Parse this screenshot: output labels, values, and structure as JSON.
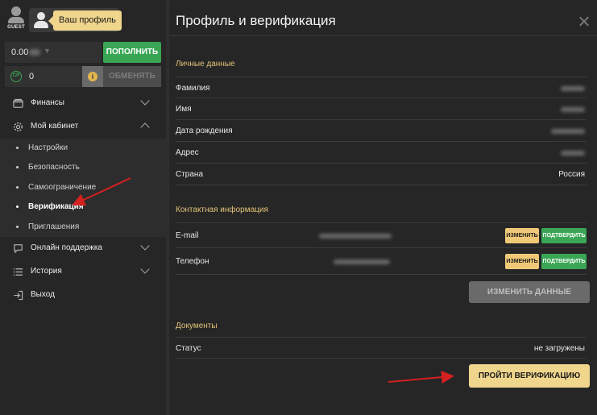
{
  "header": {
    "guest_label": "GUEST",
    "profile_suffix": "ru",
    "tooltip": "Ваш профиль"
  },
  "balance": {
    "value_prefix": "0.00",
    "topup_label": "ПОПОЛНИТЬ"
  },
  "cp": {
    "icon_text": "CP",
    "value": "0",
    "exchange_label": "ОБМЕНЯТЬ"
  },
  "nav": {
    "finance": "Финансы",
    "cabinet": "Мой кабинет",
    "cabinet_items": [
      "Настройки",
      "Безопасность",
      "Самоограничение",
      "Верификация",
      "Приглашения"
    ],
    "support": "Онлайн поддержка",
    "history": "История",
    "logout": "Выход"
  },
  "panel": {
    "title": "Профиль и верификация",
    "personal": {
      "title": "Личные данные",
      "rows": [
        {
          "label": "Фамилия",
          "value": ""
        },
        {
          "label": "Имя",
          "value": ""
        },
        {
          "label": "Дата рождения",
          "value": ""
        },
        {
          "label": "Адрес",
          "value": ""
        },
        {
          "label": "Страна",
          "value": "Россия"
        }
      ]
    },
    "contact": {
      "title": "Контактная информация",
      "rows": [
        {
          "label": "E-mail",
          "edit": "ИЗМЕНИТЬ",
          "confirm": "ПОДТВЕРДИТЬ"
        },
        {
          "label": "Телефон",
          "edit": "ИЗМЕНИТЬ",
          "confirm": "ПОДТВЕРДИТЬ"
        }
      ]
    },
    "change_data": "ИЗМЕНИТЬ ДАННЫЕ",
    "documents": {
      "title": "Документы",
      "status_label": "Статус",
      "status_value": "не загружены"
    },
    "verify_button": "ПРОЙТИ ВЕРИФИКАЦИЮ"
  },
  "colors": {
    "accent_green": "#3aa655",
    "accent_gold": "#f0d58d",
    "section_title": "#e3c27a",
    "annotation_arrow": "#d42020"
  }
}
